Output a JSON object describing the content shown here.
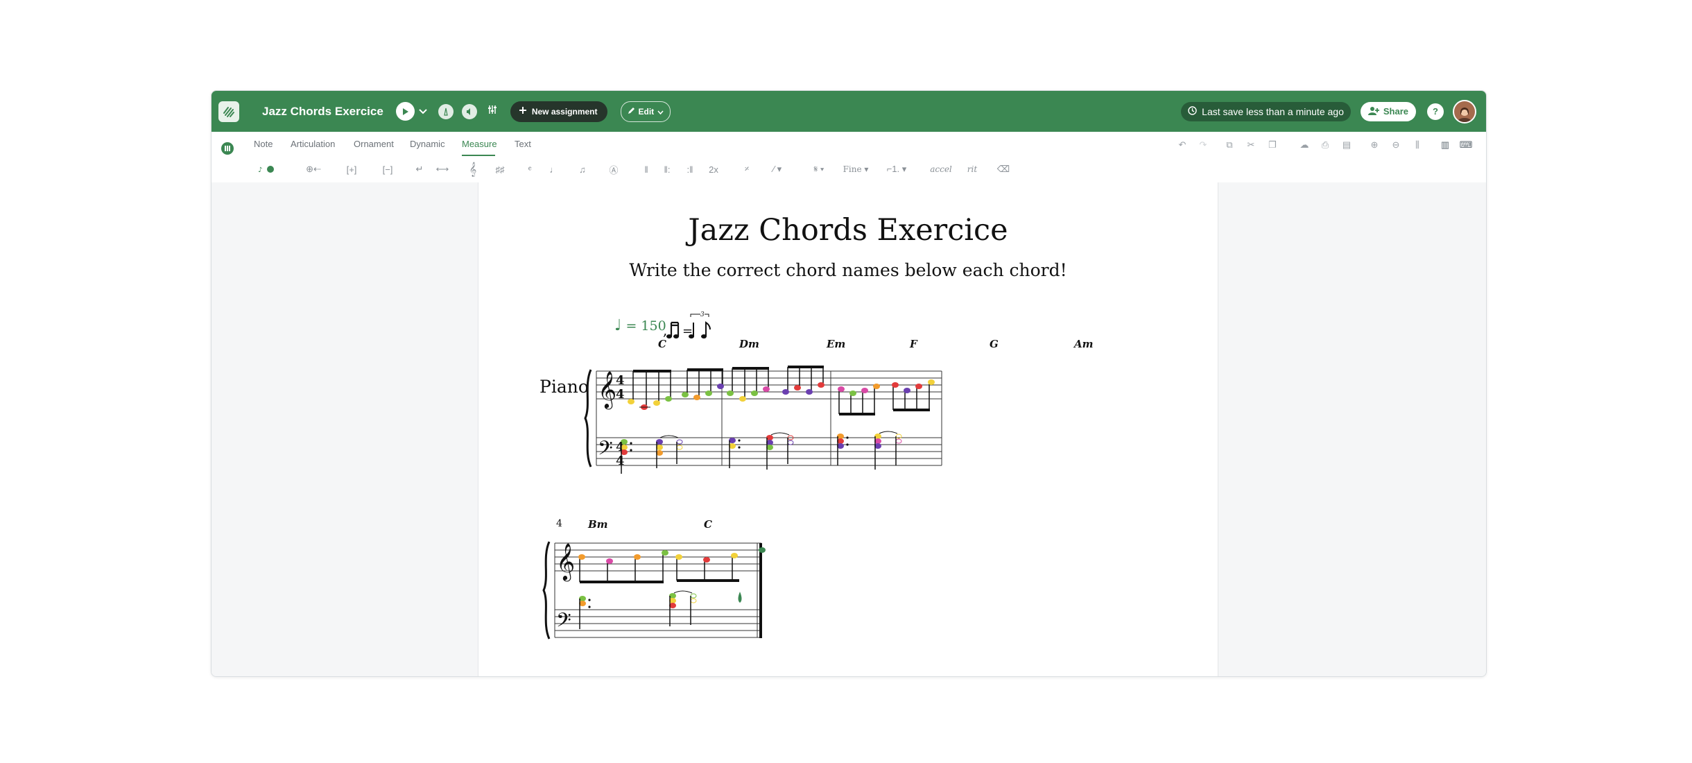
{
  "header": {
    "title": "Jazz Chords Exercice",
    "new_assignment_label": "New assignment",
    "edit_label": "Edit",
    "save_status": "Last save less than a minute ago",
    "share_label": "Share",
    "help_label": "?"
  },
  "tabs": [
    "Note",
    "Articulation",
    "Ornament",
    "Dynamic",
    "Measure",
    "Text"
  ],
  "active_tab": "Measure",
  "toolbar": {
    "multiplier_label": "2x",
    "fine_label": "Fine",
    "accel_label": "accel",
    "rit_label": "rit"
  },
  "score": {
    "title": "Jazz Chords Exercice",
    "subtitle": "Write the correct chord names below each chord!",
    "instrument": "Piano",
    "tempo_text": "= 150",
    "swing_triplet": "3",
    "time_signature": "4/4",
    "measure_number": "4",
    "chords_system1": [
      "C",
      "Dm",
      "Em",
      "F",
      "G",
      "Am"
    ],
    "chords_system2": [
      "Bm",
      "C"
    ]
  },
  "colors": {
    "header_green": "#3b8752",
    "note_yellow": "#f2d13a",
    "note_red": "#e23b3b",
    "note_orange": "#f29b2c",
    "note_green": "#7bc143",
    "note_purple": "#6a3fb0",
    "note_pink": "#d94aa6"
  }
}
